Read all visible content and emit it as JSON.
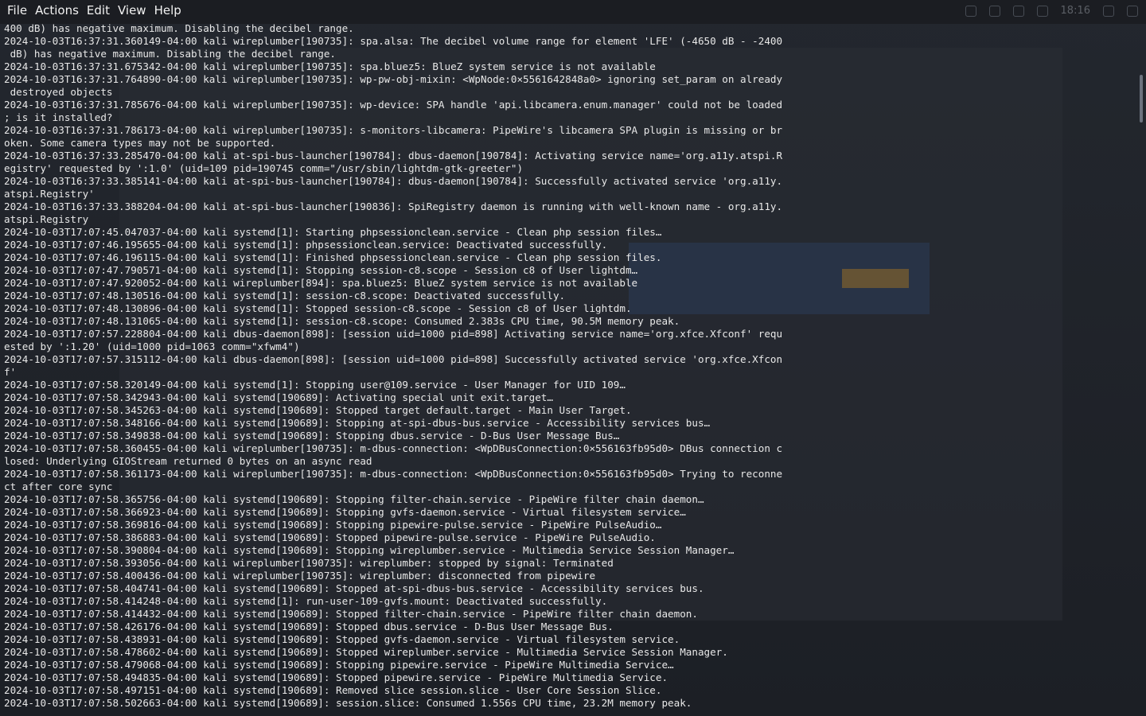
{
  "menubar": {
    "items": [
      "File",
      "Actions",
      "Edit",
      "View",
      "Help"
    ]
  },
  "tray": {
    "clock": "18:16"
  },
  "log": {
    "lines": [
      "400 dB) has negative maximum. Disabling the decibel range.",
      "2024-10-03T16:37:31.360149-04:00 kali wireplumber[190735]: spa.alsa: The decibel volume range for element 'LFE' (-4650 dB - -2400",
      " dB) has negative maximum. Disabling the decibel range.",
      "2024-10-03T16:37:31.675342-04:00 kali wireplumber[190735]: spa.bluez5: BlueZ system service is not available",
      "2024-10-03T16:37:31.764890-04:00 kali wireplumber[190735]: wp-pw-obj-mixin: <WpNode:0×5561642848a0> ignoring set_param on already",
      " destroyed objects",
      "2024-10-03T16:37:31.785676-04:00 kali wireplumber[190735]: wp-device: SPA handle 'api.libcamera.enum.manager' could not be loaded",
      "; is it installed?",
      "2024-10-03T16:37:31.786173-04:00 kali wireplumber[190735]: s-monitors-libcamera: PipeWire's libcamera SPA plugin is missing or br",
      "oken. Some camera types may not be supported.",
      "2024-10-03T16:37:33.285470-04:00 kali at-spi-bus-launcher[190784]: dbus-daemon[190784]: Activating service name='org.a11y.atspi.R",
      "egistry' requested by ':1.0' (uid=109 pid=190745 comm=\"/usr/sbin/lightdm-gtk-greeter\")",
      "2024-10-03T16:37:33.385141-04:00 kali at-spi-bus-launcher[190784]: dbus-daemon[190784]: Successfully activated service 'org.a11y.",
      "atspi.Registry'",
      "2024-10-03T16:37:33.388204-04:00 kali at-spi-bus-launcher[190836]: SpiRegistry daemon is running with well-known name - org.a11y.",
      "atspi.Registry",
      "2024-10-03T17:07:45.047037-04:00 kali systemd[1]: Starting phpsessionclean.service - Clean php session files…",
      "2024-10-03T17:07:46.195655-04:00 kali systemd[1]: phpsessionclean.service: Deactivated successfully.",
      "2024-10-03T17:07:46.196115-04:00 kali systemd[1]: Finished phpsessionclean.service - Clean php session files.",
      "2024-10-03T17:07:47.790571-04:00 kali systemd[1]: Stopping session-c8.scope - Session c8 of User lightdm…",
      "2024-10-03T17:07:47.920052-04:00 kali wireplumber[894]: spa.bluez5: BlueZ system service is not available",
      "2024-10-03T17:07:48.130516-04:00 kali systemd[1]: session-c8.scope: Deactivated successfully.",
      "2024-10-03T17:07:48.130896-04:00 kali systemd[1]: Stopped session-c8.scope - Session c8 of User lightdm.",
      "2024-10-03T17:07:48.131065-04:00 kali systemd[1]: session-c8.scope: Consumed 2.383s CPU time, 90.5M memory peak.",
      "2024-10-03T17:07:57.228804-04:00 kali dbus-daemon[898]: [session uid=1000 pid=898] Activating service name='org.xfce.Xfconf' requ",
      "ested by ':1.20' (uid=1000 pid=1063 comm=\"xfwm4\")",
      "2024-10-03T17:07:57.315112-04:00 kali dbus-daemon[898]: [session uid=1000 pid=898] Successfully activated service 'org.xfce.Xfcon",
      "f'",
      "2024-10-03T17:07:58.320149-04:00 kali systemd[1]: Stopping user@109.service - User Manager for UID 109…",
      "2024-10-03T17:07:58.342943-04:00 kali systemd[190689]: Activating special unit exit.target…",
      "2024-10-03T17:07:58.345263-04:00 kali systemd[190689]: Stopped target default.target - Main User Target.",
      "2024-10-03T17:07:58.348166-04:00 kali systemd[190689]: Stopping at-spi-dbus-bus.service - Accessibility services bus…",
      "2024-10-03T17:07:58.349838-04:00 kali systemd[190689]: Stopping dbus.service - D-Bus User Message Bus…",
      "2024-10-03T17:07:58.360455-04:00 kali wireplumber[190735]: m-dbus-connection: <WpDBusConnection:0×556163fb95d0> DBus connection c",
      "losed: Underlying GIOStream returned 0 bytes on an async read",
      "2024-10-03T17:07:58.361173-04:00 kali wireplumber[190735]: m-dbus-connection: <WpDBusConnection:0×556163fb95d0> Trying to reconne",
      "ct after core sync",
      "2024-10-03T17:07:58.365756-04:00 kali systemd[190689]: Stopping filter-chain.service - PipeWire filter chain daemon…",
      "2024-10-03T17:07:58.366923-04:00 kali systemd[190689]: Stopping gvfs-daemon.service - Virtual filesystem service…",
      "2024-10-03T17:07:58.369816-04:00 kali systemd[190689]: Stopping pipewire-pulse.service - PipeWire PulseAudio…",
      "2024-10-03T17:07:58.386883-04:00 kali systemd[190689]: Stopped pipewire-pulse.service - PipeWire PulseAudio.",
      "2024-10-03T17:07:58.390804-04:00 kali systemd[190689]: Stopping wireplumber.service - Multimedia Service Session Manager…",
      "2024-10-03T17:07:58.393056-04:00 kali wireplumber[190735]: wireplumber: stopped by signal: Terminated",
      "2024-10-03T17:07:58.400436-04:00 kali wireplumber[190735]: wireplumber: disconnected from pipewire",
      "2024-10-03T17:07:58.404741-04:00 kali systemd[190689]: Stopped at-spi-dbus-bus.service - Accessibility services bus.",
      "2024-10-03T17:07:58.414248-04:00 kali systemd[1]: run-user-109-gvfs.mount: Deactivated successfully.",
      "2024-10-03T17:07:58.414432-04:00 kali systemd[190689]: Stopped filter-chain.service - PipeWire filter chain daemon.",
      "2024-10-03T17:07:58.426176-04:00 kali systemd[190689]: Stopped dbus.service - D-Bus User Message Bus.",
      "2024-10-03T17:07:58.438931-04:00 kali systemd[190689]: Stopped gvfs-daemon.service - Virtual filesystem service.",
      "2024-10-03T17:07:58.478602-04:00 kali systemd[190689]: Stopped wireplumber.service - Multimedia Service Session Manager.",
      "2024-10-03T17:07:58.479068-04:00 kali systemd[190689]: Stopping pipewire.service - PipeWire Multimedia Service…",
      "2024-10-03T17:07:58.494835-04:00 kali systemd[190689]: Stopped pipewire.service - PipeWire Multimedia Service.",
      "2024-10-03T17:07:58.497151-04:00 kali systemd[190689]: Removed slice session.slice - User Core Session Slice.",
      "2024-10-03T17:07:58.502663-04:00 kali systemd[190689]: session.slice: Consumed 1.556s CPU time, 23.2M memory peak."
    ]
  }
}
